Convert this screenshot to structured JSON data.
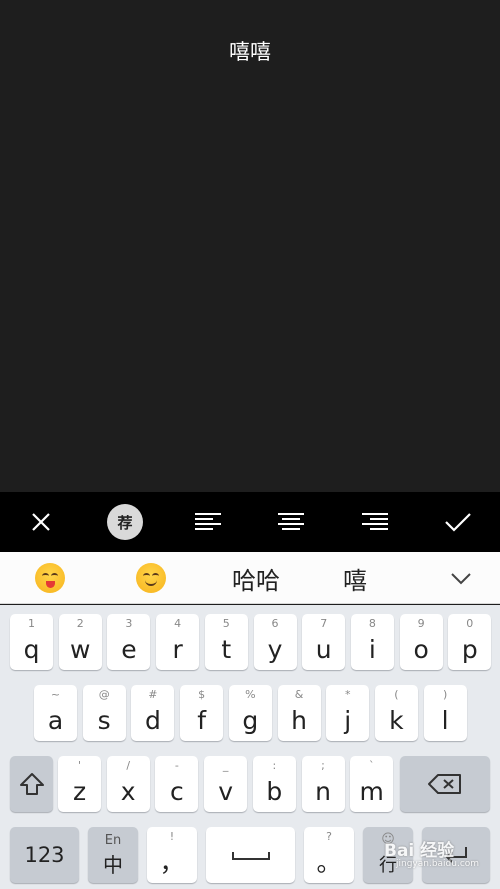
{
  "canvas": {
    "text": "嘻嘻"
  },
  "toolbar": {
    "recommend_label": "荐"
  },
  "candidates": {
    "emoji1": "yum-face",
    "emoji2": "smiling-face",
    "word1": "哈哈",
    "word2": "嘻"
  },
  "keyboard": {
    "row1": [
      {
        "main": "q",
        "sub": "1"
      },
      {
        "main": "w",
        "sub": "2"
      },
      {
        "main": "e",
        "sub": "3"
      },
      {
        "main": "r",
        "sub": "4"
      },
      {
        "main": "t",
        "sub": "5"
      },
      {
        "main": "y",
        "sub": "6"
      },
      {
        "main": "u",
        "sub": "7"
      },
      {
        "main": "i",
        "sub": "8"
      },
      {
        "main": "o",
        "sub": "9"
      },
      {
        "main": "p",
        "sub": "0"
      }
    ],
    "row2": [
      {
        "main": "a",
        "sub": "~"
      },
      {
        "main": "s",
        "sub": "@"
      },
      {
        "main": "d",
        "sub": "#"
      },
      {
        "main": "f",
        "sub": "$"
      },
      {
        "main": "g",
        "sub": "%"
      },
      {
        "main": "h",
        "sub": "&"
      },
      {
        "main": "j",
        "sub": "*"
      },
      {
        "main": "k",
        "sub": "("
      },
      {
        "main": "l",
        "sub": ")"
      }
    ],
    "row3": [
      {
        "main": "z",
        "sub": "'"
      },
      {
        "main": "x",
        "sub": "/"
      },
      {
        "main": "c",
        "sub": "-"
      },
      {
        "main": "v",
        "sub": "_"
      },
      {
        "main": "b",
        "sub": ":"
      },
      {
        "main": "n",
        "sub": ";"
      },
      {
        "main": "m",
        "sub": "`"
      }
    ],
    "num_label": "123",
    "lang_top": "En",
    "lang_main": "中",
    "comma_sub": "!",
    "comma_main": "，",
    "period_sub": "?",
    "period_main": "。",
    "enter_label": "行"
  },
  "watermark": {
    "brand": "Bai 经验",
    "url": "jingyan.baidu.com"
  }
}
